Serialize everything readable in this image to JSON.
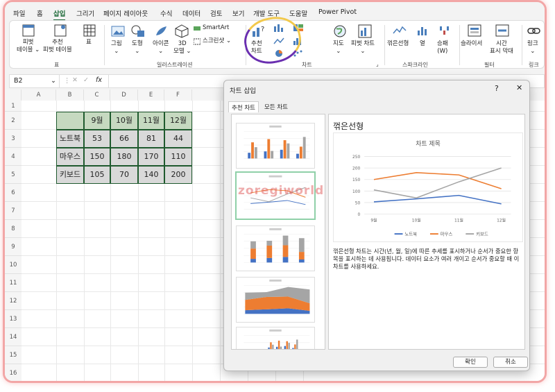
{
  "menu_tabs": [
    "파일",
    "홈",
    "삽입",
    "그리기",
    "페이지 레이아웃",
    "수식",
    "데이터",
    "검토",
    "보기",
    "개발 도구",
    "도움말",
    "Power Pivot"
  ],
  "ribbon": {
    "pivot": "피벗\n테이블 ⌄",
    "rec_pivot": "추천\n피벗 테이블",
    "table": "표",
    "picture": "그림\n⌄",
    "shapes": "도형\n⌄",
    "icons": "아이콘\n⌄",
    "model3d": "3D\n모델 ⌄",
    "smartart": "SmartArt",
    "screenshot": "스크린샷 ⌄",
    "rec_chart": "추천\n차트",
    "map": "지도\n⌄",
    "pivot_chart": "피벗 차트\n⌄",
    "spark_line": "꺾은선형",
    "spark_col": "열",
    "spark_wl": "승패\n(W)",
    "slicer": "슬라이서",
    "timeline": "시간\n표시 막대",
    "link": "링크\n⌄",
    "groups": {
      "table": "표",
      "illustration": "일러스트레이션",
      "chart": "차트",
      "spark": "스파크라인",
      "filter": "필터",
      "link": "링크"
    }
  },
  "formula_bar": {
    "name_box": "B2",
    "fx": "fx"
  },
  "columns": [
    "A",
    "B",
    "C",
    "D",
    "E",
    "F"
  ],
  "rows": [
    "1",
    "2",
    "3",
    "4",
    "5",
    "6",
    "7",
    "8",
    "9",
    "10",
    "11",
    "12",
    "13",
    "14",
    "15",
    "16"
  ],
  "table": {
    "header": [
      "",
      "9월",
      "10월",
      "11월",
      "12월"
    ],
    "rows": [
      [
        "노트북",
        "53",
        "66",
        "81",
        "44"
      ],
      [
        "마우스",
        "150",
        "180",
        "170",
        "110"
      ],
      [
        "키보드",
        "105",
        "70",
        "140",
        "200"
      ]
    ]
  },
  "dialog": {
    "title": "차트 삽입",
    "help": "?",
    "close": "✕",
    "tabs": [
      "추천 차트",
      "모든 차트"
    ],
    "preview_name": "꺾은선형",
    "chart_title": "차트 제목",
    "description": "꺾은선형 차트는 시간(년, 월, 일)에 따른 추세를 표시하거나 순서가 중요한 항목을 표시하는 데 사용됩니다. 데이터 요소가 여러 개이고 순서가 중요할 때 이 차트를 사용하세요.",
    "ok": "확인",
    "cancel": "취소"
  },
  "watermark": "zoregiworld",
  "chart_data": {
    "type": "line",
    "title": "차트 제목",
    "categories": [
      "9월",
      "10월",
      "11월",
      "12월"
    ],
    "ylim": [
      0,
      250
    ],
    "yticks": [
      0,
      50,
      100,
      150,
      200,
      250
    ],
    "series": [
      {
        "name": "노트북",
        "values": [
          53,
          66,
          81,
          44
        ],
        "color": "#4472c4"
      },
      {
        "name": "마우스",
        "values": [
          150,
          180,
          170,
          110
        ],
        "color": "#ed7d31"
      },
      {
        "name": "키보드",
        "values": [
          105,
          70,
          140,
          200
        ],
        "color": "#a5a5a5"
      }
    ],
    "legend": "bottom"
  }
}
